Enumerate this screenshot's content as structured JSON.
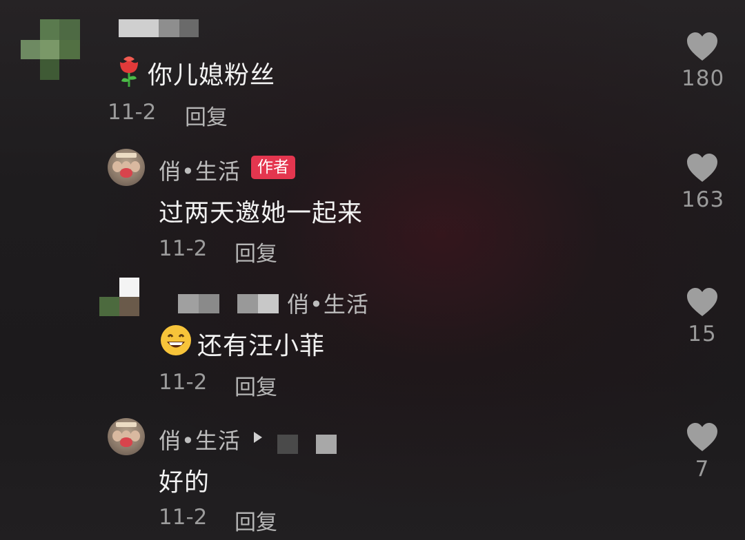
{
  "comments": [
    {
      "content": "你儿媳粉丝",
      "date": "11-2",
      "reply_label": "回复",
      "likes": "180",
      "content_emoji": "rose-icon"
    },
    {
      "author": "俏•生活",
      "badge": "作者",
      "content": "过两天邀她一起来",
      "date": "11-2",
      "reply_label": "回复",
      "likes": "163"
    },
    {
      "reply_to": "俏•生活",
      "content": "还有汪小菲",
      "content_emoji": "grinning-face-icon",
      "date": "11-2",
      "reply_label": "回复",
      "likes": "15"
    },
    {
      "author": "俏•生活",
      "content": "好的",
      "date": "11-2",
      "reply_label": "回复",
      "likes": "7"
    }
  ],
  "icons": {
    "like": "heart-icon",
    "reply_arrow": "play-arrow-icon"
  },
  "colors": {
    "badge": "#e4364f",
    "background": "#1e1c1e"
  }
}
